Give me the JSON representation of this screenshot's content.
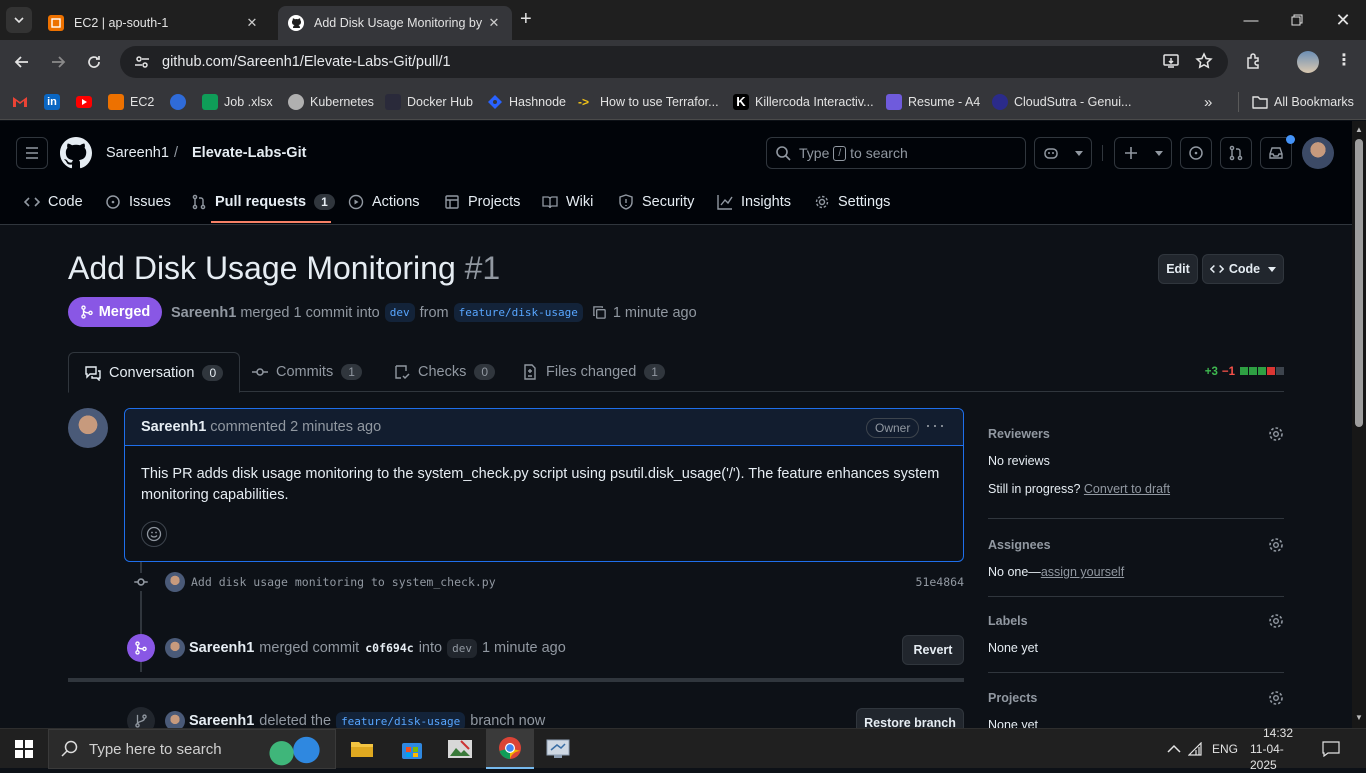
{
  "browser": {
    "tabs": [
      {
        "title": "EC2 | ap-south-1",
        "icon": "aws-icon"
      },
      {
        "title": "Add Disk Usage Monitoring by",
        "icon": "github-icon"
      }
    ],
    "url": "github.com/Sareenh1/Elevate-Labs-Git/pull/1",
    "bookmarks": [
      "EC2",
      "Job .xlsx",
      "Kubernetes",
      "Docker Hub",
      "Hashnode",
      "How to use Terrafor...",
      "Killercoda Interactiv...",
      "Resume - A4",
      "CloudSutra - Genui..."
    ],
    "all_bookmarks": "All Bookmarks"
  },
  "github": {
    "owner": "Sareenh1",
    "repo": "Elevate-Labs-Git",
    "search_placeholder_pre": "Type",
    "search_key": "/",
    "search_placeholder_post": "to search",
    "nav": {
      "code": "Code",
      "issues": "Issues",
      "pulls": "Pull requests",
      "pulls_count": "1",
      "actions": "Actions",
      "projects": "Projects",
      "wiki": "Wiki",
      "security": "Security",
      "insights": "Insights",
      "settings": "Settings"
    }
  },
  "pr": {
    "title": "Add Disk Usage Monitoring",
    "number": "#1",
    "edit": "Edit",
    "code": "Code",
    "state": "Merged",
    "author": "Sareenh1",
    "merged_text": "merged 1 commit into",
    "base": "dev",
    "from": "from",
    "head": "feature/disk-usage",
    "time": "1 minute ago",
    "tabs": {
      "conversation": "Conversation",
      "conversation_count": "0",
      "commits": "Commits",
      "commits_count": "1",
      "checks": "Checks",
      "checks_count": "0",
      "files": "Files changed",
      "files_count": "1"
    },
    "diffstat": {
      "add": "+3",
      "del": "−1",
      "add_ratio": 0.75
    }
  },
  "comment": {
    "author": "Sareenh1",
    "meta": "commented 2 minutes ago",
    "badge": "Owner",
    "body": "This PR adds disk usage monitoring to the system_check.py script using psutil.disk_usage('/'). The feature enhances system monitoring capabilities."
  },
  "timeline": {
    "commit_msg": "Add disk usage monitoring to system_check.py",
    "commit_sha": "51e4864",
    "merge_author": "Sareenh1",
    "merge_text": "merged commit",
    "merge_sha": "c0f694c",
    "merge_into": "into",
    "merge_base": "dev",
    "merge_time": "1 minute ago",
    "revert": "Revert",
    "delete_author": "Sareenh1",
    "delete_text": "deleted the",
    "delete_branch": "feature/disk-usage",
    "delete_time": "branch now",
    "restore": "Restore branch"
  },
  "sidebar": {
    "reviewers_h": "Reviewers",
    "reviewers_v": "No reviews",
    "progress": "Still in progress?",
    "draft": "Convert to draft",
    "assignees_h": "Assignees",
    "assignees_v": "No one—",
    "assign_self": "assign yourself",
    "labels_h": "Labels",
    "labels_v": "None yet",
    "projects_h": "Projects",
    "projects_v": "None yet"
  },
  "taskbar": {
    "search": "Type here to search",
    "lang": "ENG",
    "time": "14:32",
    "date": "11-04-2025"
  }
}
